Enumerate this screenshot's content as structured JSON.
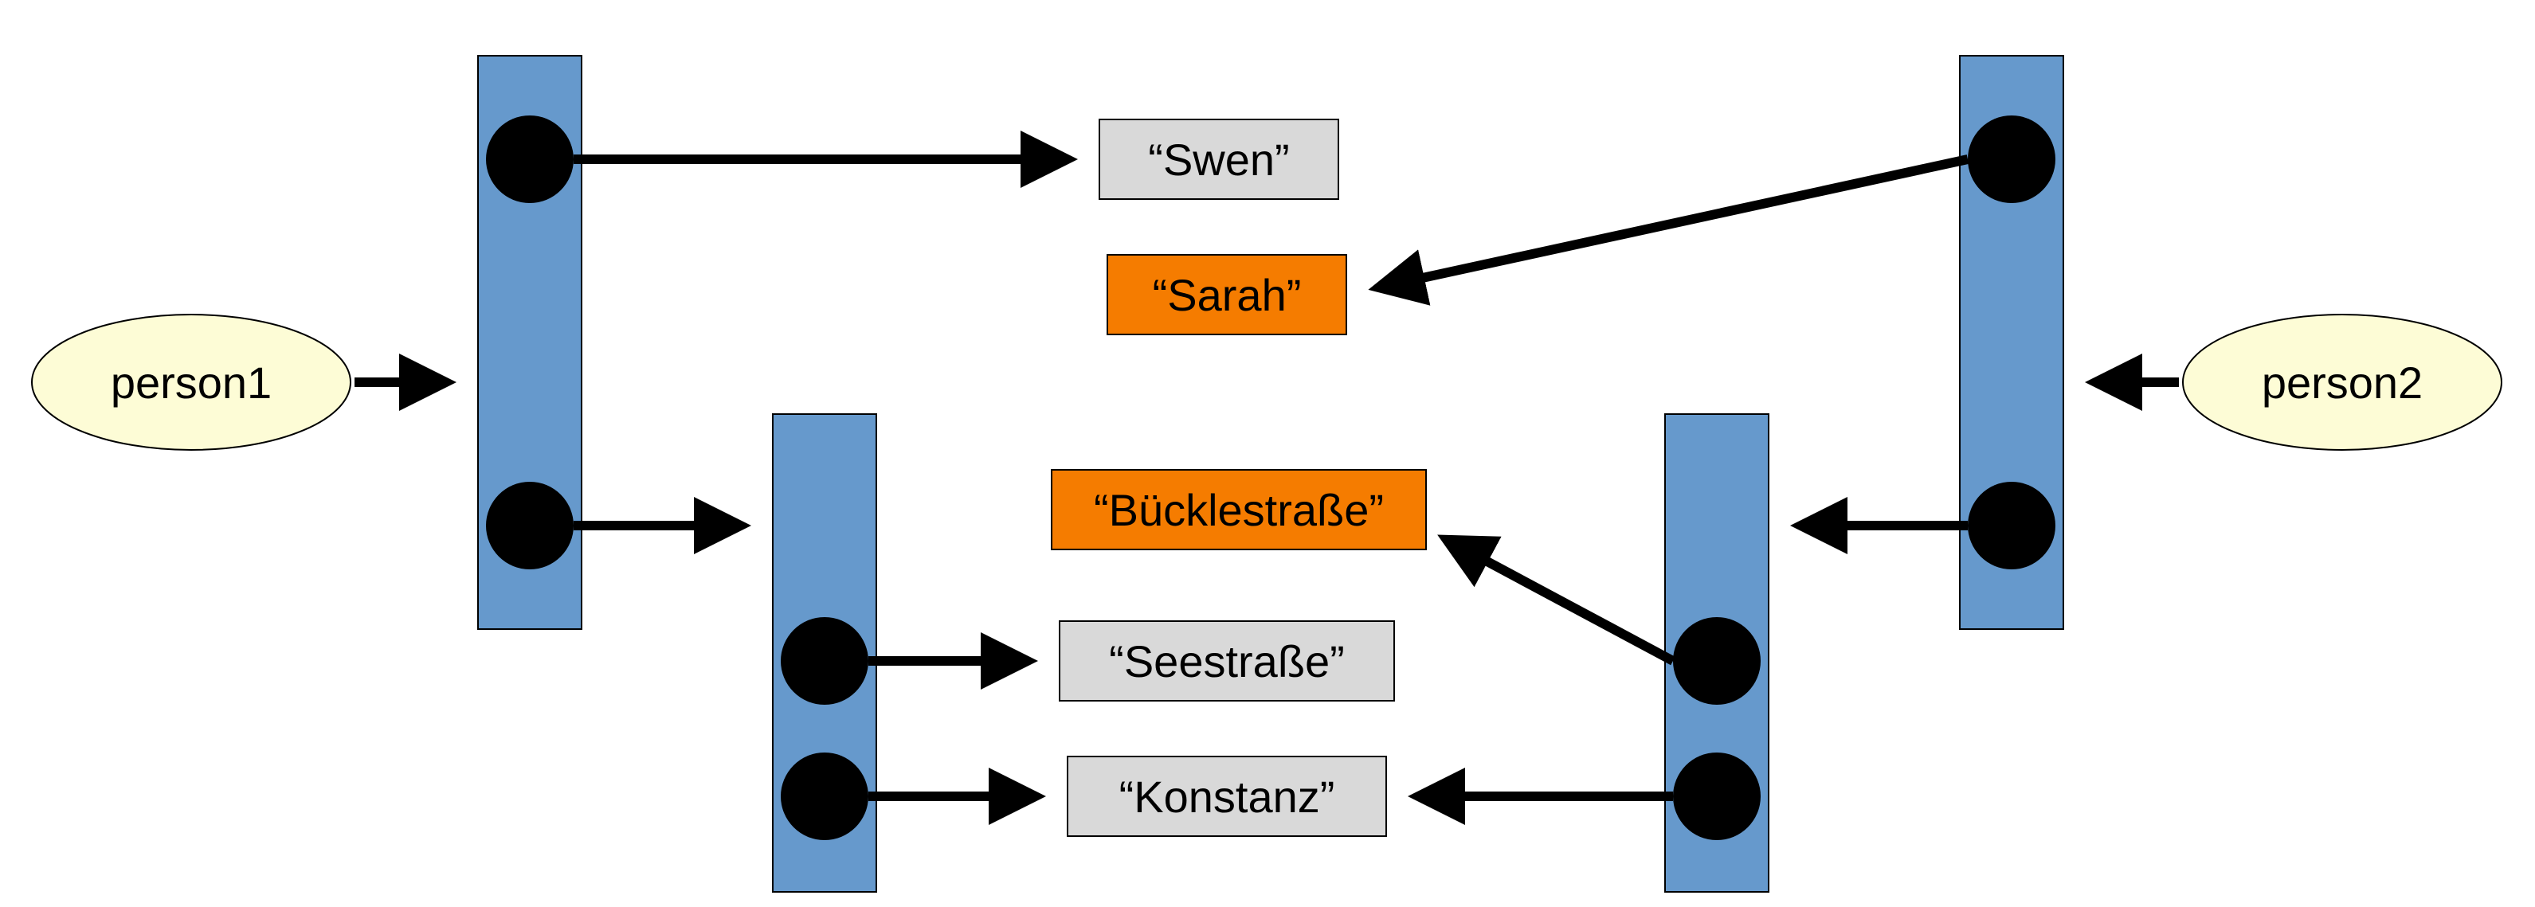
{
  "entities": {
    "left": {
      "label": "person1"
    },
    "right": {
      "label": "person2"
    }
  },
  "values": {
    "swen": {
      "text": "“Swen”",
      "highlighted": false
    },
    "sarah": {
      "text": "“Sarah”",
      "highlighted": true
    },
    "bueckle": {
      "text": "“Bücklestraße”",
      "highlighted": true
    },
    "see": {
      "text": "“Seestraße”",
      "highlighted": false
    },
    "konstanz": {
      "text": "“Konstanz”",
      "highlighted": false
    }
  },
  "colors": {
    "bar": "#6699CC",
    "ellipse": "#FDFCD6",
    "highlight": "#F57C00",
    "neutral": "#D9D9D9"
  }
}
